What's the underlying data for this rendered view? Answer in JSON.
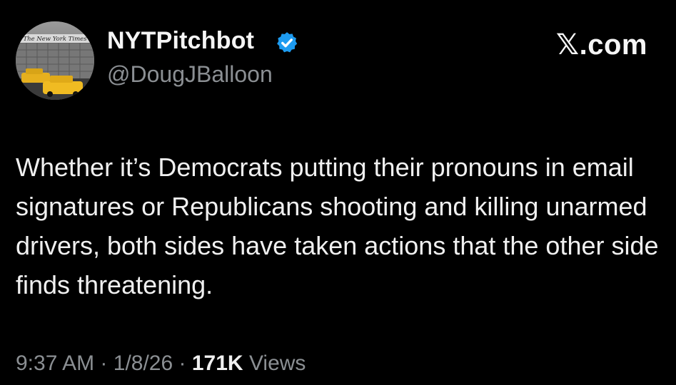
{
  "tweet": {
    "author": {
      "display_name": "NYTPitchbot",
      "handle": "@DougJBalloon",
      "verified": true,
      "avatar_sign_text": "The New York Times"
    },
    "brand": "𝕏.com",
    "text": "Whether it’s Democrats putting their pronouns in email signatures or Republicans shooting and killing unarmed drivers, both sides have taken actions that the other side finds threatening.",
    "time": "9:37 AM",
    "date": "1/8/26",
    "separator": "·",
    "views_count": "171K",
    "views_label": "Views",
    "colors": {
      "background": "#000000",
      "text": "#f0f0f0",
      "muted": "#8b8f93",
      "verified_badge": "#1d9bf0"
    }
  }
}
